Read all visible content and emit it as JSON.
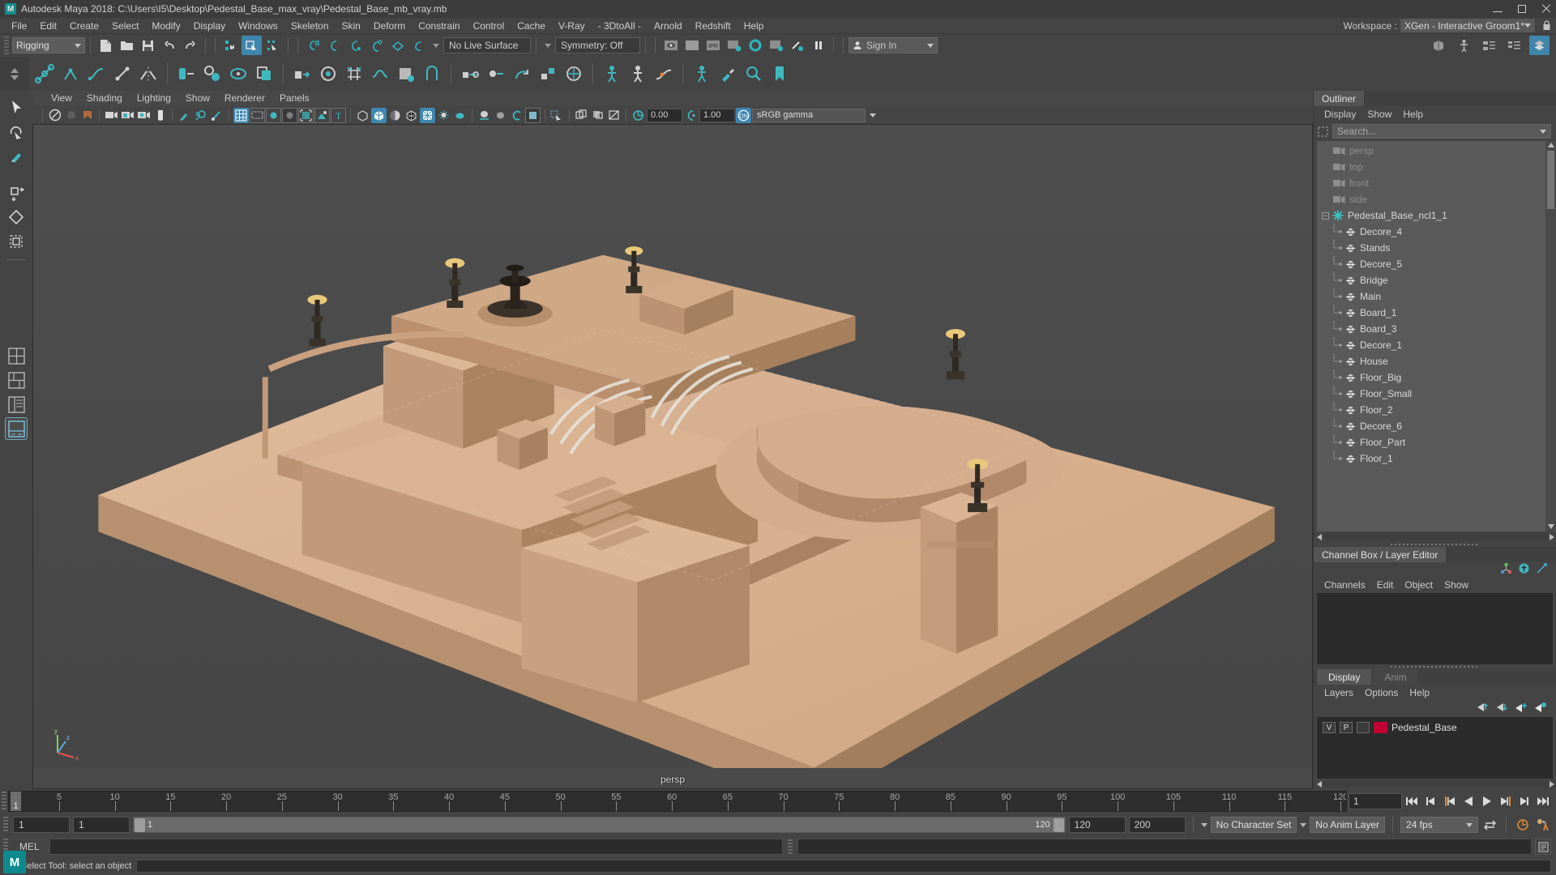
{
  "window": {
    "title": "Autodesk Maya 2018: C:\\Users\\I5\\Desktop\\Pedestal_Base_max_vray\\Pedestal_Base_mb_vray.mb",
    "logo_text": "M"
  },
  "main_menu": {
    "items": [
      "File",
      "Edit",
      "Create",
      "Select",
      "Modify",
      "Display",
      "Windows",
      "Skeleton",
      "Skin",
      "Deform",
      "Constrain",
      "Control",
      "Cache",
      "V-Ray",
      "- 3DtoAll -",
      "Arnold",
      "Redshift",
      "Help"
    ]
  },
  "workspace": {
    "label": "Workspace :",
    "value": "XGen - Interactive Groom1*"
  },
  "status_line": {
    "mode": "Rigging",
    "live_surface": "No Live Surface",
    "symmetry": "Symmetry: Off",
    "sign_in": "Sign In"
  },
  "viewport_menu": {
    "items": [
      "View",
      "Shading",
      "Lighting",
      "Show",
      "Renderer",
      "Panels"
    ]
  },
  "viewport_toolbar": {
    "exposure": "0.00",
    "gamma": "1.00",
    "color_space": "sRGB gamma"
  },
  "viewport": {
    "camera_label": "persp",
    "axis": {
      "x": "x",
      "y": "y",
      "z": "z"
    }
  },
  "outliner": {
    "tab": "Outliner",
    "menu": [
      "Display",
      "Show",
      "Help"
    ],
    "search_placeholder": "Search...",
    "items": [
      {
        "label": "persp",
        "type": "camera",
        "depth": 1
      },
      {
        "label": "top",
        "type": "camera",
        "depth": 1
      },
      {
        "label": "front",
        "type": "camera",
        "depth": 1
      },
      {
        "label": "side",
        "type": "camera",
        "depth": 1
      },
      {
        "label": "Pedestal_Base_ncl1_1",
        "type": "group",
        "depth": 0,
        "expanded": true
      },
      {
        "label": "Decore_4",
        "type": "mesh",
        "depth": 1
      },
      {
        "label": "Stands",
        "type": "mesh",
        "depth": 1
      },
      {
        "label": "Decore_5",
        "type": "mesh",
        "depth": 1
      },
      {
        "label": "Bridge",
        "type": "mesh",
        "depth": 1
      },
      {
        "label": "Main",
        "type": "mesh",
        "depth": 1
      },
      {
        "label": "Board_1",
        "type": "mesh",
        "depth": 1
      },
      {
        "label": "Board_3",
        "type": "mesh",
        "depth": 1
      },
      {
        "label": "Decore_1",
        "type": "mesh",
        "depth": 1
      },
      {
        "label": "House",
        "type": "mesh",
        "depth": 1
      },
      {
        "label": "Floor_Big",
        "type": "mesh",
        "depth": 1
      },
      {
        "label": "Floor_Small",
        "type": "mesh",
        "depth": 1
      },
      {
        "label": "Floor_2",
        "type": "mesh",
        "depth": 1
      },
      {
        "label": "Decore_6",
        "type": "mesh",
        "depth": 1
      },
      {
        "label": "Floor_Part",
        "type": "mesh",
        "depth": 1
      },
      {
        "label": "Floor_1",
        "type": "mesh",
        "depth": 1
      }
    ]
  },
  "channel_box": {
    "tab": "Channel Box / Layer Editor",
    "menu": [
      "Channels",
      "Edit",
      "Object",
      "Show"
    ]
  },
  "layer_editor": {
    "tabs": [
      {
        "label": "Display",
        "active": true
      },
      {
        "label": "Anim",
        "active": false
      }
    ],
    "menu": [
      "Layers",
      "Options",
      "Help"
    ],
    "columns": {
      "visibility": "V",
      "playback": "P"
    },
    "layers": [
      {
        "visible": "V",
        "playback": "P",
        "color": "#c00030",
        "name": "Pedestal_Base"
      }
    ]
  },
  "timeline": {
    "ticks": [
      5,
      10,
      15,
      20,
      25,
      30,
      35,
      40,
      45,
      50,
      55,
      60,
      65,
      70,
      75,
      80,
      85,
      90,
      95,
      100,
      105,
      110,
      115,
      120
    ],
    "start": 1,
    "end": 120,
    "current_frame": "1",
    "current_frame_field": "1"
  },
  "range_slider": {
    "anim_start": "1",
    "range_start": "1",
    "bar_start": "1",
    "bar_end": "120",
    "range_end": "120",
    "anim_end": "200",
    "character_set": "No Character Set",
    "anim_layer": "No Anim Layer",
    "fps": "24 fps"
  },
  "command_line": {
    "language": "MEL",
    "input": "",
    "output": ""
  },
  "help_line": {
    "text": "Select Tool: select an object"
  },
  "colors": {
    "accent": "#3f86ad",
    "teal": "#3fb8c0",
    "panel_bg": "#444444",
    "field_bg": "#2b2b2b",
    "list_bg": "#5a5a5a",
    "model_light": "#d9b89a",
    "model_mid": "#c9a183",
    "model_dark": "#a8815f",
    "layer_swatch": "#c00030"
  }
}
